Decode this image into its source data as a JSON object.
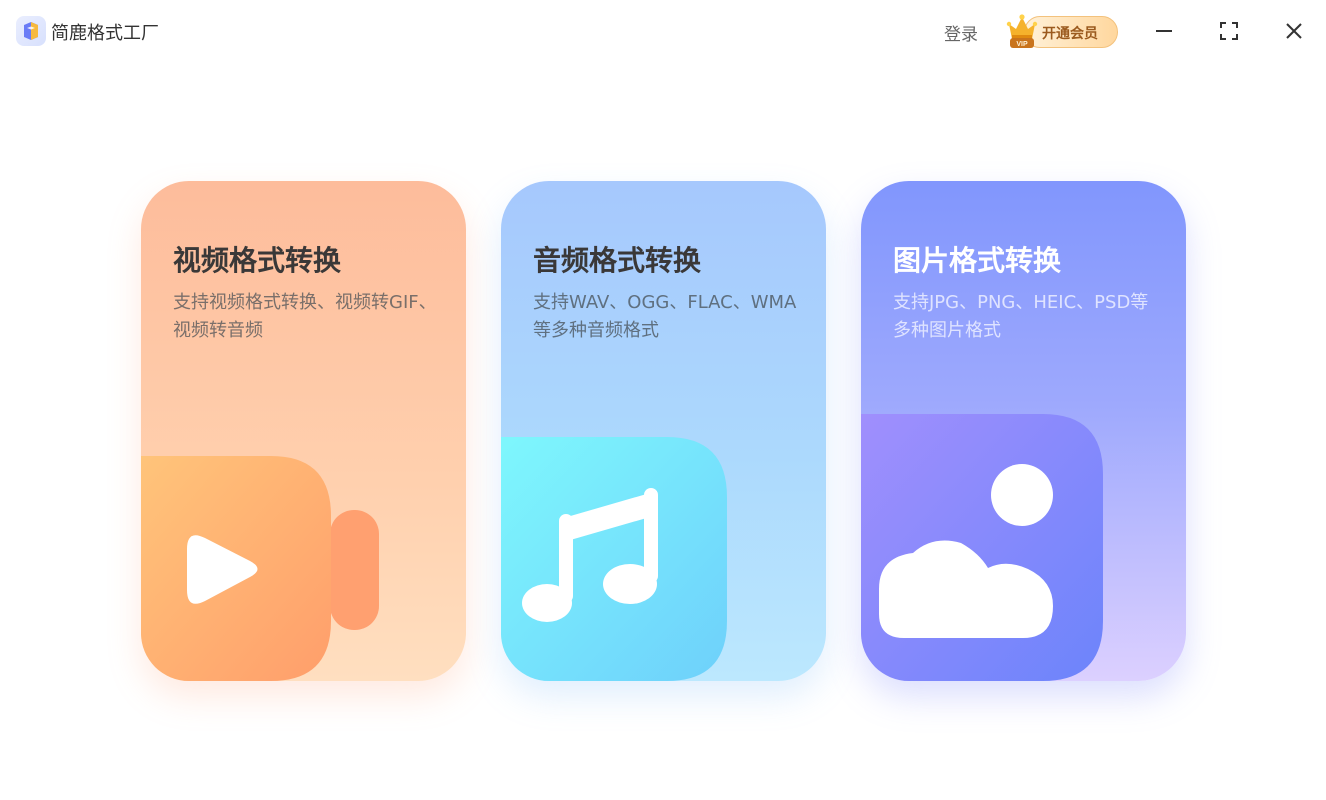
{
  "app": {
    "title": "简鹿格式工厂",
    "logo_icon": "app-logo-icon"
  },
  "header": {
    "login_label": "登录",
    "vip_label": "开通会员",
    "vip_badge": "VIP",
    "vip_icon": "crown-icon",
    "window_controls": [
      "minimize-icon",
      "maximize-icon",
      "close-icon"
    ]
  },
  "cards": [
    {
      "title": "视频格式转换",
      "description": "支持视频格式转换、视频转GIF、视频转音频",
      "icon": "video-camera-icon",
      "accent": "#fdbc9b"
    },
    {
      "title": "音频格式转换",
      "description": "支持WAV、OGG、FLAC、WMA等多种音频格式",
      "icon": "music-note-icon",
      "accent": "#a6c8fd"
    },
    {
      "title": "图片格式转换",
      "description": "支持JPG、PNG、HEIC、PSD等多种图片格式",
      "icon": "image-icon",
      "accent": "#8196fd"
    }
  ]
}
